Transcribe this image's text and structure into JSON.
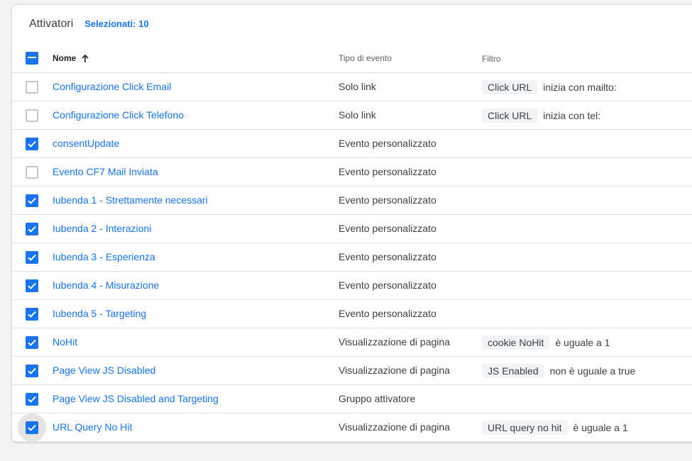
{
  "header": {
    "title": "Attivatori",
    "selected": "Selezionati: 10"
  },
  "columns": {
    "name": "Nome",
    "type": "Tipo di evento",
    "filter": "Filtro",
    "sort_icon": "arrow-up-icon"
  },
  "colors": {
    "accent": "#1a73e8"
  },
  "rows": [
    {
      "name": "Configurazione Click Email",
      "type": "Solo link",
      "checked": false,
      "filter_chip": "Click URL",
      "filter_text": "inizia con mailto:"
    },
    {
      "name": "Configurazione Click Telefono",
      "type": "Solo link",
      "checked": false,
      "filter_chip": "Click URL",
      "filter_text": "inizia con tel:"
    },
    {
      "name": "consentUpdate",
      "type": "Evento personalizzato",
      "checked": true
    },
    {
      "name": "Evento CF7 Mail Inviata",
      "type": "Evento personalizzato",
      "checked": false
    },
    {
      "name": "Iubenda 1 - Strettamente necessari",
      "type": "Evento personalizzato",
      "checked": true
    },
    {
      "name": "Iubenda 2 - Interazioni",
      "type": "Evento personalizzato",
      "checked": true
    },
    {
      "name": "Iubenda 3 - Esperienza",
      "type": "Evento personalizzato",
      "checked": true
    },
    {
      "name": "Iubenda 4 - Misurazione",
      "type": "Evento personalizzato",
      "checked": true
    },
    {
      "name": "Iubenda 5 - Targeting",
      "type": "Evento personalizzato",
      "checked": true
    },
    {
      "name": "NoHit",
      "type": "Visualizzazione di pagina",
      "checked": true,
      "filter_chip": "cookie NoHit",
      "filter_text": "è uguale a 1"
    },
    {
      "name": "Page View JS Disabled",
      "type": "Visualizzazione di pagina",
      "checked": true,
      "filter_chip": "JS Enabled",
      "filter_text": "non è uguale a true"
    },
    {
      "name": "Page View JS Disabled and Targeting",
      "type": "Gruppo attivatore",
      "checked": true
    },
    {
      "name": "URL Query No Hit",
      "type": "Visualizzazione di pagina",
      "checked": true,
      "hover": true,
      "filter_chip": "URL query no hit",
      "filter_text": "è uguale a 1"
    }
  ]
}
